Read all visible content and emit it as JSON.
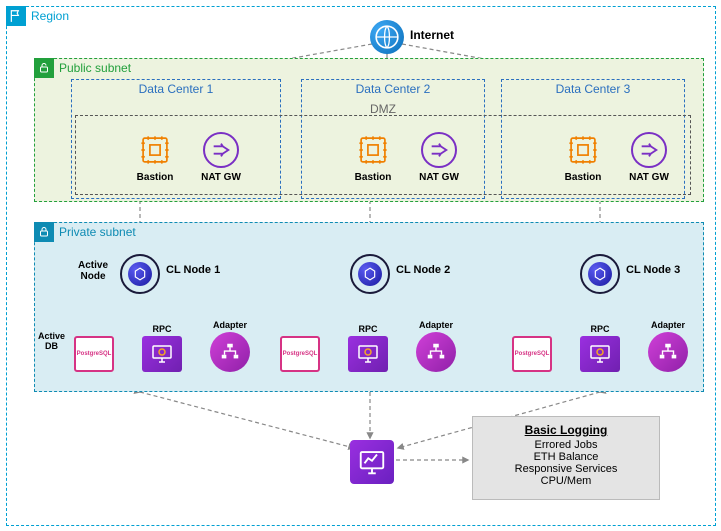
{
  "region": {
    "label": "Region"
  },
  "internet": {
    "label": "Internet"
  },
  "public_subnet": {
    "label": "Public subnet"
  },
  "private_subnet": {
    "label": "Private subnet"
  },
  "dmz": {
    "label": "DMZ"
  },
  "datacenters": [
    {
      "label": "Data Center 1",
      "bastion": "Bastion",
      "natgw": "NAT GW"
    },
    {
      "label": "Data Center 2",
      "bastion": "Bastion",
      "natgw": "NAT GW"
    },
    {
      "label": "Data Center 3",
      "bastion": "Bastion",
      "natgw": "NAT GW"
    }
  ],
  "cl_nodes": [
    {
      "label": "CL Node 1"
    },
    {
      "label": "CL Node 2"
    },
    {
      "label": "CL Node 3"
    }
  ],
  "active_node": "Active\nNode",
  "active_db": "Active\nDB",
  "services": {
    "postgres": "PostgreSQL",
    "rpc": "RPC",
    "adapter": "Adapter"
  },
  "logging": {
    "title": "Basic Logging",
    "items": [
      "Errored Jobs",
      "ETH Balance",
      "Responsive Services",
      "CPU/Mem"
    ]
  }
}
